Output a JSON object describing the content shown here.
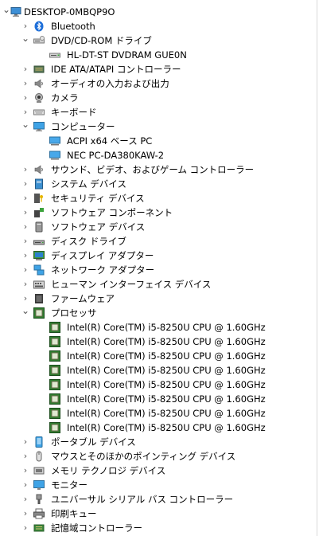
{
  "computer_name": "DESKTOP-0MBQP9O",
  "categories": [
    {
      "label": "Bluetooth",
      "icon": "bluetooth-icon"
    },
    {
      "label": "DVD/CD-ROM ドライブ",
      "icon": "dvd-drive-icon",
      "children": [
        "HL-DT-ST DVDRAM GUE0N"
      ]
    },
    {
      "label": "IDE ATA/ATAPI コントローラー",
      "icon": "ide-controller-icon"
    },
    {
      "label": "オーディオの入力および出力",
      "icon": "speaker-icon"
    },
    {
      "label": "カメラ",
      "icon": "camera-icon"
    },
    {
      "label": "キーボード",
      "icon": "keyboard-icon"
    },
    {
      "label": "コンピューター",
      "icon": "computer-icon",
      "children": [
        "ACPI x64 ベース PC",
        "NEC PC-DA380KAW-2"
      ]
    },
    {
      "label": "サウンド、ビデオ、およびゲーム コントローラー",
      "icon": "sound-icon"
    },
    {
      "label": "システム デバイス",
      "icon": "system-devices-icon"
    },
    {
      "label": "セキュリティ デバイス",
      "icon": "security-device-icon"
    },
    {
      "label": "ソフトウェア コンポーネント",
      "icon": "software-component-icon"
    },
    {
      "label": "ソフトウェア デバイス",
      "icon": "software-device-icon"
    },
    {
      "label": "ディスク ドライブ",
      "icon": "disk-drive-icon"
    },
    {
      "label": "ディスプレイ アダプター",
      "icon": "display-adapter-icon"
    },
    {
      "label": "ネットワーク アダプター",
      "icon": "network-adapter-icon"
    },
    {
      "label": "ヒューマン インターフェイス デバイス",
      "icon": "hid-icon"
    },
    {
      "label": "ファームウェア",
      "icon": "firmware-icon"
    },
    {
      "label": "プロセッサ",
      "icon": "processor-icon",
      "children": [
        "Intel(R) Core(TM) i5-8250U CPU @ 1.60GHz",
        "Intel(R) Core(TM) i5-8250U CPU @ 1.60GHz",
        "Intel(R) Core(TM) i5-8250U CPU @ 1.60GHz",
        "Intel(R) Core(TM) i5-8250U CPU @ 1.60GHz",
        "Intel(R) Core(TM) i5-8250U CPU @ 1.60GHz",
        "Intel(R) Core(TM) i5-8250U CPU @ 1.60GHz",
        "Intel(R) Core(TM) i5-8250U CPU @ 1.60GHz",
        "Intel(R) Core(TM) i5-8250U CPU @ 1.60GHz"
      ]
    },
    {
      "label": "ポータブル デバイス",
      "icon": "portable-device-icon"
    },
    {
      "label": "マウスとそのほかのポインティング デバイス",
      "icon": "mouse-icon"
    },
    {
      "label": "メモリ テクノロジ デバイス",
      "icon": "memory-device-icon"
    },
    {
      "label": "モニター",
      "icon": "monitor-icon"
    },
    {
      "label": "ユニバーサル シリアル バス コントローラー",
      "icon": "usb-icon"
    },
    {
      "label": "印刷キュー",
      "icon": "printer-icon"
    },
    {
      "label": "記憶域コントローラー",
      "icon": "storage-controller-icon"
    }
  ]
}
